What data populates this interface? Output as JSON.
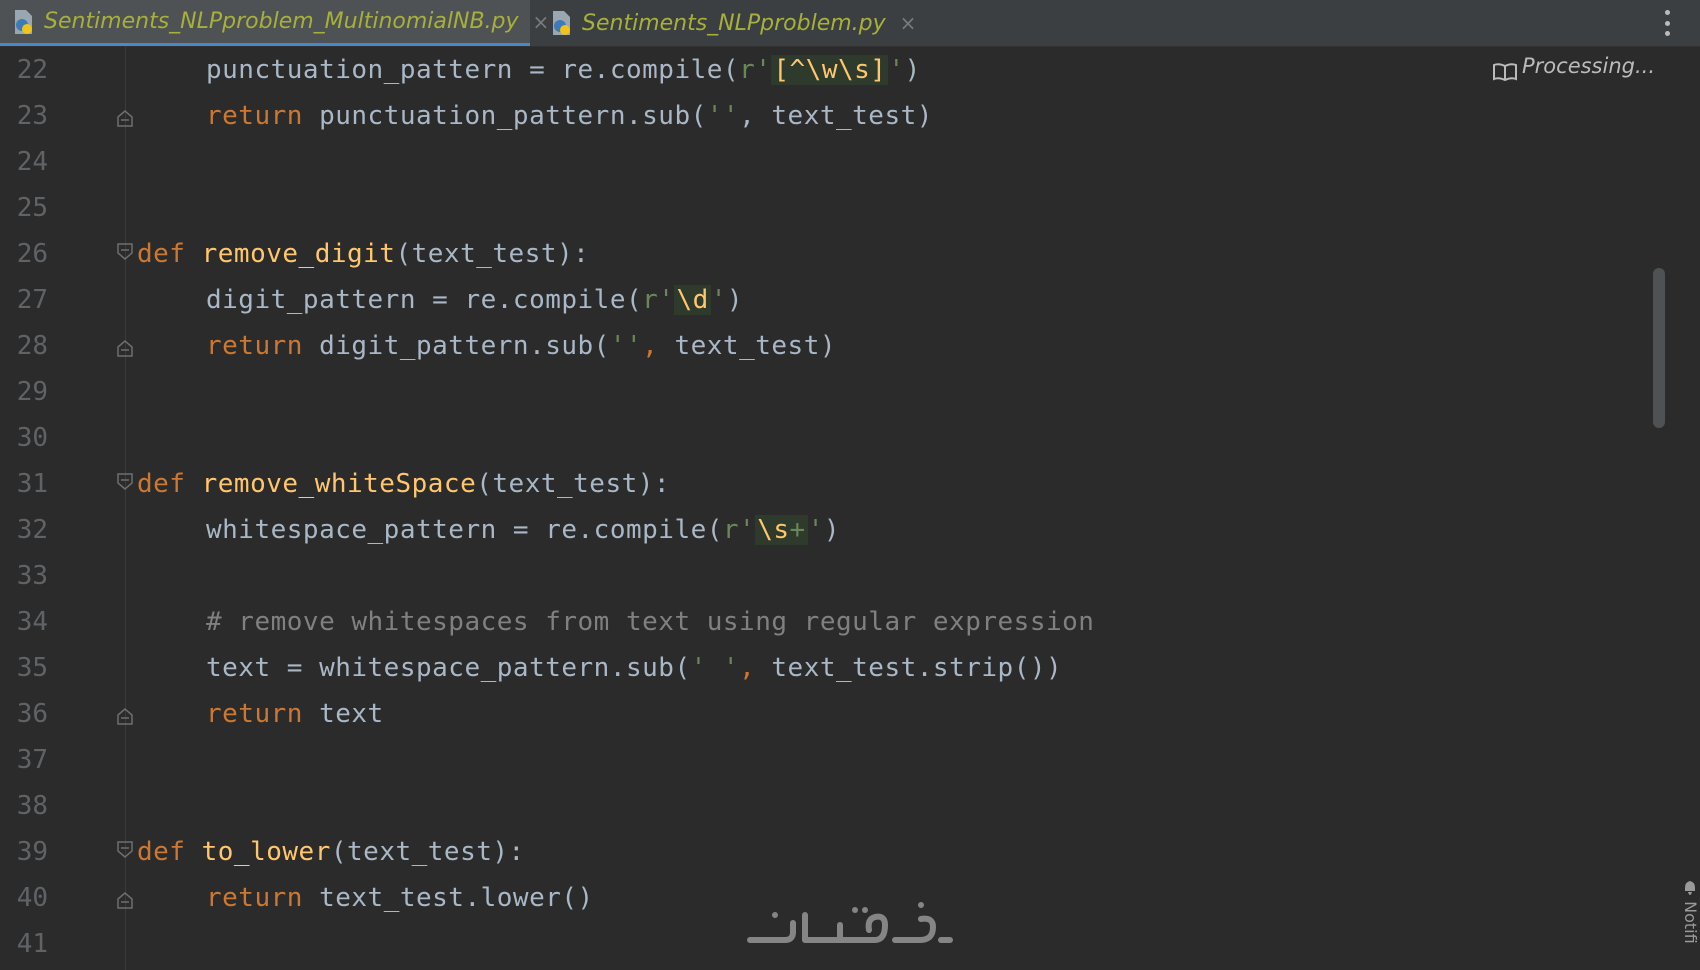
{
  "tabs": [
    {
      "label": "Sentiments_NLPproblem_MultinomialNB.py",
      "close": "×",
      "active": true
    },
    {
      "label": "Sentiments_NLPproblem.py",
      "close": "×",
      "active": false
    }
  ],
  "status": {
    "processing": "Processing..."
  },
  "notifications_label": "Notifi",
  "lines": [
    {
      "n": "22"
    },
    {
      "n": "23"
    },
    {
      "n": "24"
    },
    {
      "n": "25"
    },
    {
      "n": "26"
    },
    {
      "n": "27"
    },
    {
      "n": "28"
    },
    {
      "n": "29"
    },
    {
      "n": "30"
    },
    {
      "n": "31"
    },
    {
      "n": "32"
    },
    {
      "n": "33"
    },
    {
      "n": "34"
    },
    {
      "n": "35"
    },
    {
      "n": "36"
    },
    {
      "n": "37"
    },
    {
      "n": "38"
    },
    {
      "n": "39"
    },
    {
      "n": "40"
    },
    {
      "n": "41"
    }
  ],
  "code": {
    "l22": {
      "a": "punctuation_pattern = re.compile(",
      "b": "r'",
      "rx": "[^\\w\\s]",
      "c": "'",
      "d": ")"
    },
    "l23": {
      "kw": "return",
      "a": " punctuation_pattern.sub(",
      "s": "''",
      "b": ", text_test)"
    },
    "l26": {
      "kw": "def",
      "fn": " remove_digit",
      "a": "(text_test):"
    },
    "l27": {
      "a": "digit_pattern = re.compile(",
      "b": "r'",
      "rx": "\\d",
      "c": "'",
      "d": ")"
    },
    "l28": {
      "kw": "return",
      "a": " digit_pattern.sub(",
      "s": "''",
      "sep": ",",
      "b": " text_test)"
    },
    "l31": {
      "kw": "def",
      "fn": " remove_whiteSpace",
      "a": "(text_test):"
    },
    "l32": {
      "a": "whitespace_pattern = re.compile(",
      "b": "r'",
      "rx": "\\s",
      "plus": "+",
      "c": "'",
      "d": ")"
    },
    "l34": {
      "cm": "# remove whitespaces from text using regular expression"
    },
    "l35": {
      "a": "text = whitespace_pattern.sub(",
      "s": "' '",
      "sep": ",",
      "b": " text_test.strip())"
    },
    "l36": {
      "kw": "return",
      "a": " text"
    },
    "l39": {
      "kw": "def",
      "fn": " to_lower",
      "a": "(text_test):"
    },
    "l40": {
      "kw": "return",
      "a": " text_test.lower()"
    }
  },
  "watermark": "خمسات",
  "colors": {
    "background": "#2b2b2b",
    "keyword": "#cc7832",
    "function": "#ffc66d",
    "string": "#6a8759",
    "comment": "#808080",
    "text": "#a9b7c6",
    "tab_text": "#a8b03a"
  },
  "icons": {
    "tab_file": "python-file-icon",
    "reader": "reader-mode-icon",
    "menu": "more-vertical-icon",
    "fold": "fold-marker-icon"
  }
}
